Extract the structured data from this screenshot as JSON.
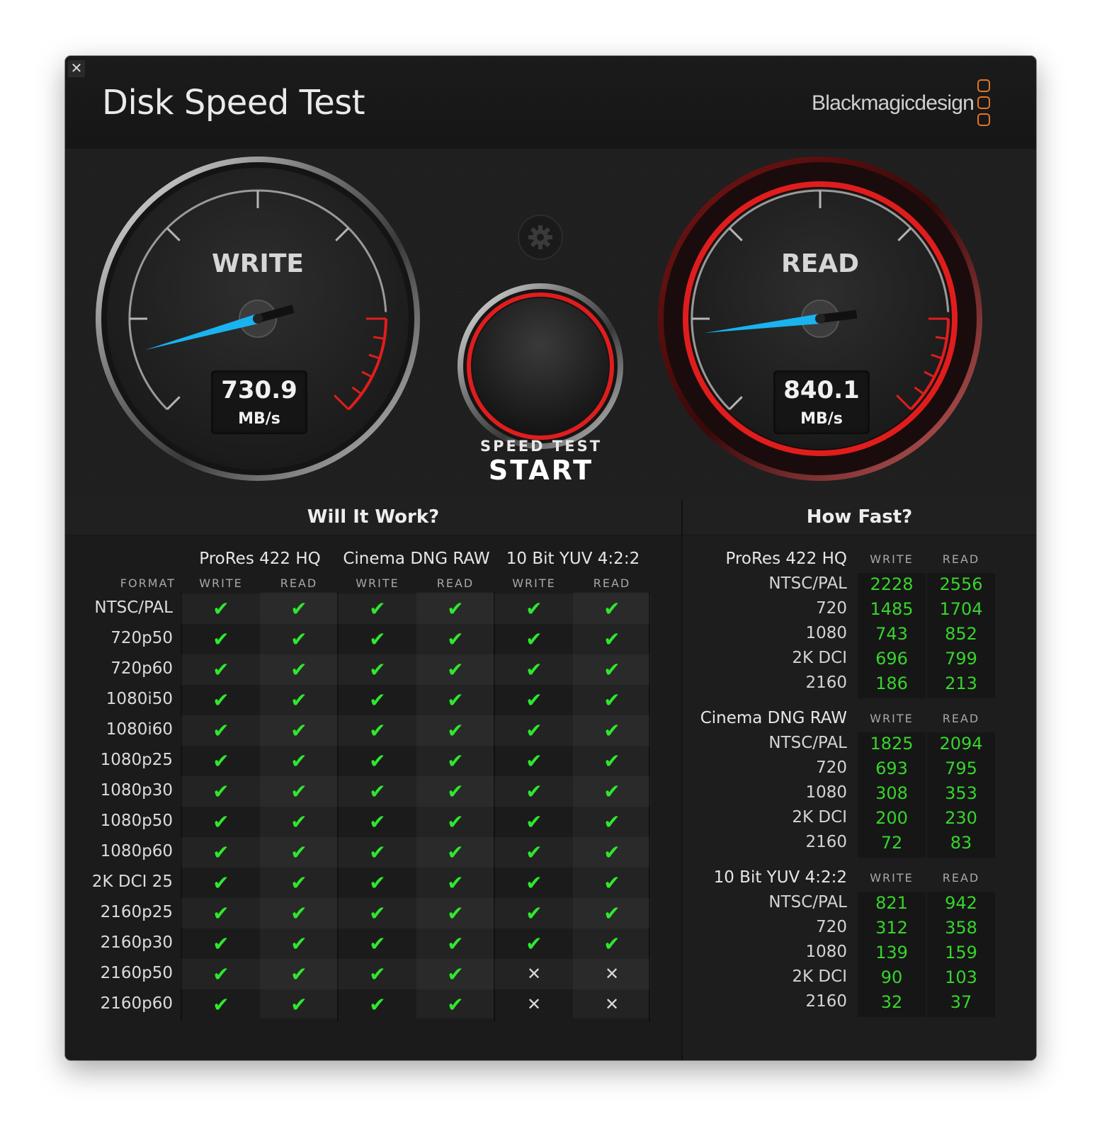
{
  "app": {
    "title": "Disk Speed Test",
    "brand": "Blackmagicdesign",
    "close_glyph": "✕"
  },
  "gauges": {
    "write": {
      "label": "WRITE",
      "value": "730.9",
      "unit": "MB/s",
      "needle_color": "#1ab3f0"
    },
    "read": {
      "label": "READ",
      "value": "840.1",
      "unit": "MB/s",
      "needle_color": "#1ab3f0",
      "ring_color": "#e01d1d"
    },
    "settings_icon": "gear-icon"
  },
  "start_button": {
    "top": "SPEED TEST",
    "main": "START",
    "ring_color": "#e01d1d"
  },
  "will_it_work": {
    "heading": "Will It Work?",
    "format_header": "FORMAT",
    "codecs": [
      {
        "name": "ProRes 422 HQ",
        "write": "WRITE",
        "read": "READ"
      },
      {
        "name": "Cinema DNG RAW",
        "write": "WRITE",
        "read": "READ"
      },
      {
        "name": "10 Bit YUV 4:2:2",
        "write": "WRITE",
        "read": "READ"
      }
    ],
    "ok_glyph": "✔",
    "no_glyph": "✕",
    "rows": [
      {
        "format": "NTSC/PAL",
        "marks": [
          true,
          true,
          true,
          true,
          true,
          true
        ]
      },
      {
        "format": "720p50",
        "marks": [
          true,
          true,
          true,
          true,
          true,
          true
        ]
      },
      {
        "format": "720p60",
        "marks": [
          true,
          true,
          true,
          true,
          true,
          true
        ]
      },
      {
        "format": "1080i50",
        "marks": [
          true,
          true,
          true,
          true,
          true,
          true
        ]
      },
      {
        "format": "1080i60",
        "marks": [
          true,
          true,
          true,
          true,
          true,
          true
        ]
      },
      {
        "format": "1080p25",
        "marks": [
          true,
          true,
          true,
          true,
          true,
          true
        ]
      },
      {
        "format": "1080p30",
        "marks": [
          true,
          true,
          true,
          true,
          true,
          true
        ]
      },
      {
        "format": "1080p50",
        "marks": [
          true,
          true,
          true,
          true,
          true,
          true
        ]
      },
      {
        "format": "1080p60",
        "marks": [
          true,
          true,
          true,
          true,
          true,
          true
        ]
      },
      {
        "format": "2K DCI 25",
        "marks": [
          true,
          true,
          true,
          true,
          true,
          true
        ]
      },
      {
        "format": "2160p25",
        "marks": [
          true,
          true,
          true,
          true,
          true,
          true
        ]
      },
      {
        "format": "2160p30",
        "marks": [
          true,
          true,
          true,
          true,
          true,
          true
        ]
      },
      {
        "format": "2160p50",
        "marks": [
          true,
          true,
          true,
          true,
          false,
          false
        ]
      },
      {
        "format": "2160p60",
        "marks": [
          true,
          true,
          true,
          true,
          false,
          false
        ]
      }
    ]
  },
  "how_fast": {
    "heading": "How Fast?",
    "groups": [
      {
        "name": "ProRes 422 HQ",
        "write": "WRITE",
        "read": "READ",
        "rows": [
          {
            "label": "NTSC/PAL",
            "write": "2228",
            "read": "2556"
          },
          {
            "label": "720",
            "write": "1485",
            "read": "1704"
          },
          {
            "label": "1080",
            "write": "743",
            "read": "852"
          },
          {
            "label": "2K DCI",
            "write": "696",
            "read": "799"
          },
          {
            "label": "2160",
            "write": "186",
            "read": "213"
          }
        ]
      },
      {
        "name": "Cinema DNG RAW",
        "write": "WRITE",
        "read": "READ",
        "rows": [
          {
            "label": "NTSC/PAL",
            "write": "1825",
            "read": "2094"
          },
          {
            "label": "720",
            "write": "693",
            "read": "795"
          },
          {
            "label": "1080",
            "write": "308",
            "read": "353"
          },
          {
            "label": "2K DCI",
            "write": "200",
            "read": "230"
          },
          {
            "label": "2160",
            "write": "72",
            "read": "83"
          }
        ]
      },
      {
        "name": "10 Bit YUV 4:2:2",
        "write": "WRITE",
        "read": "READ",
        "rows": [
          {
            "label": "NTSC/PAL",
            "write": "821",
            "read": "942"
          },
          {
            "label": "720",
            "write": "312",
            "read": "358"
          },
          {
            "label": "1080",
            "write": "139",
            "read": "159"
          },
          {
            "label": "2K DCI",
            "write": "90",
            "read": "103"
          },
          {
            "label": "2160",
            "write": "32",
            "read": "37"
          }
        ]
      }
    ]
  }
}
